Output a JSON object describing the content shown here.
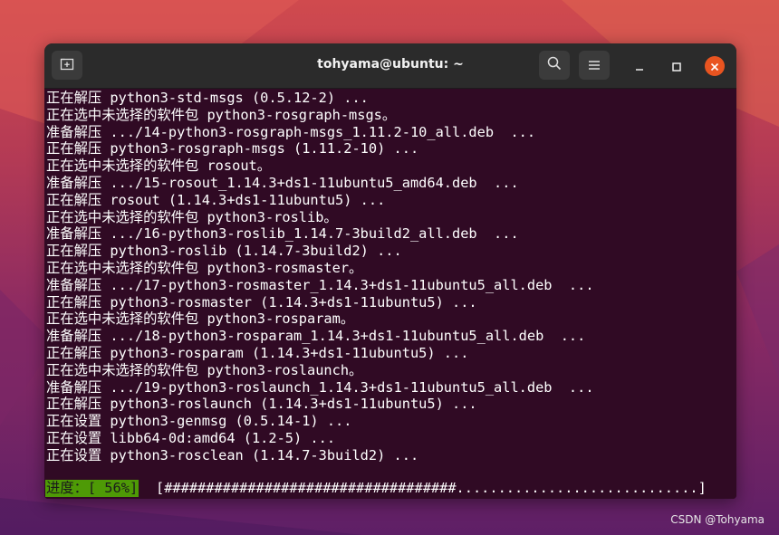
{
  "window": {
    "title": "tohyama@ubuntu: ~"
  },
  "titlebar": {
    "new_tab_icon": "new-tab-icon",
    "search_icon": "search-icon",
    "menu_icon": "hamburger-menu-icon",
    "minimize_icon": "minimize-icon",
    "maximize_icon": "maximize-icon",
    "close_icon": "close-icon"
  },
  "terminal": {
    "lines": [
      "正在解压 python3-std-msgs (0.5.12-2) ...",
      "正在选中未选择的软件包 python3-rosgraph-msgs。",
      "准备解压 .../14-python3-rosgraph-msgs_1.11.2-10_all.deb  ...",
      "正在解压 python3-rosgraph-msgs (1.11.2-10) ...",
      "正在选中未选择的软件包 rosout。",
      "准备解压 .../15-rosout_1.14.3+ds1-11ubuntu5_amd64.deb  ...",
      "正在解压 rosout (1.14.3+ds1-11ubuntu5) ...",
      "正在选中未选择的软件包 python3-roslib。",
      "准备解压 .../16-python3-roslib_1.14.7-3build2_all.deb  ...",
      "正在解压 python3-roslib (1.14.7-3build2) ...",
      "正在选中未选择的软件包 python3-rosmaster。",
      "准备解压 .../17-python3-rosmaster_1.14.3+ds1-11ubuntu5_all.deb  ...",
      "正在解压 python3-rosmaster (1.14.3+ds1-11ubuntu5) ...",
      "正在选中未选择的软件包 python3-rosparam。",
      "准备解压 .../18-python3-rosparam_1.14.3+ds1-11ubuntu5_all.deb  ...",
      "正在解压 python3-rosparam (1.14.3+ds1-11ubuntu5) ...",
      "正在选中未选择的软件包 python3-roslaunch。",
      "准备解压 .../19-python3-roslaunch_1.14.3+ds1-11ubuntu5_all.deb  ...",
      "正在解压 python3-roslaunch (1.14.3+ds1-11ubuntu5) ...",
      "正在设置 python3-genmsg (0.5.14-1) ...",
      "正在设置 libb64-0d:amd64 (1.2-5) ...",
      "正在设置 python3-rosclean (1.14.7-3build2) ..."
    ],
    "progress_label": "进度：[ 56%]",
    "progress_percent": 56,
    "progress_bar": "[###################################.............................]"
  },
  "colors": {
    "terminal_bg": "#300a24",
    "titlebar_bg": "#2b2b2b",
    "close_button": "#e95420",
    "progress_green": "#4e9a06"
  },
  "watermark": "CSDN @Tohyama"
}
